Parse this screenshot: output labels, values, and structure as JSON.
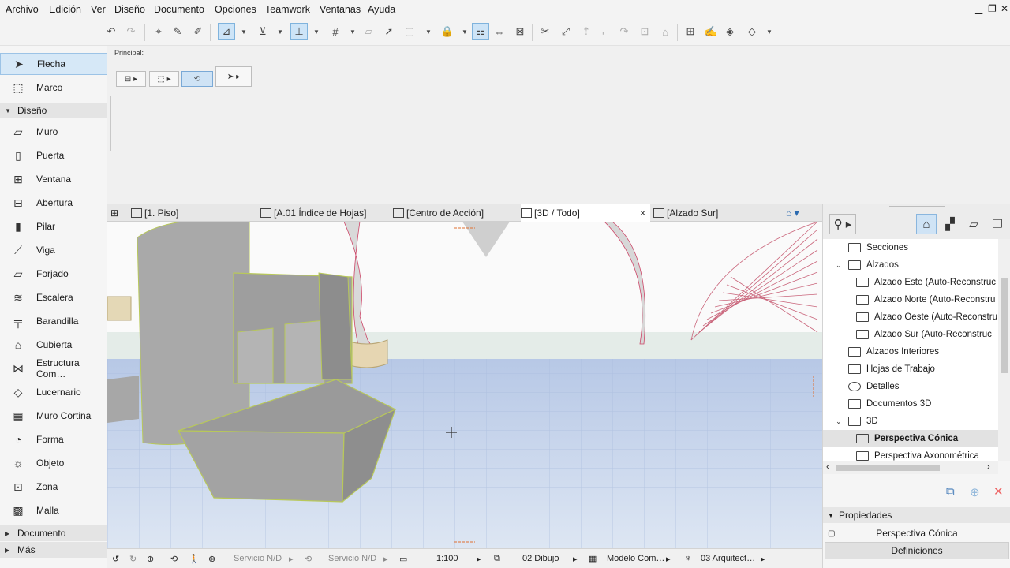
{
  "menu": [
    "Archivo",
    "Edición",
    "Ver",
    "Diseño",
    "Documento",
    "Opciones",
    "Teamwork",
    "Ventanas",
    "Ayuda"
  ],
  "infobox": {
    "label": "Principal:"
  },
  "toolbox": {
    "top_items": [
      {
        "label": "Flecha",
        "icon": "arrow-icon"
      },
      {
        "label": "Marco",
        "icon": "marquee-icon"
      }
    ],
    "group_diseno": "Diseño",
    "items": [
      {
        "label": "Muro",
        "icon": "wall-icon"
      },
      {
        "label": "Puerta",
        "icon": "door-icon"
      },
      {
        "label": "Ventana",
        "icon": "window-icon"
      },
      {
        "label": "Abertura",
        "icon": "opening-icon"
      },
      {
        "label": "Pilar",
        "icon": "column-icon"
      },
      {
        "label": "Viga",
        "icon": "beam-icon"
      },
      {
        "label": "Forjado",
        "icon": "slab-icon"
      },
      {
        "label": "Escalera",
        "icon": "stair-icon"
      },
      {
        "label": "Barandilla",
        "icon": "railing-icon"
      },
      {
        "label": "Cubierta",
        "icon": "roof-icon"
      },
      {
        "label": "Estructura Com…",
        "icon": "shell-icon"
      },
      {
        "label": "Lucernario",
        "icon": "skylight-icon"
      },
      {
        "label": "Muro Cortina",
        "icon": "curtain-wall-icon"
      },
      {
        "label": "Forma",
        "icon": "morph-icon"
      },
      {
        "label": "Objeto",
        "icon": "object-icon"
      },
      {
        "label": "Zona",
        "icon": "zone-icon"
      },
      {
        "label": "Malla",
        "icon": "mesh-icon"
      }
    ],
    "group_documento": "Documento",
    "group_mas": "Más"
  },
  "tabs": [
    {
      "label": "[1. Piso]"
    },
    {
      "label": "[A.01 Índice de Hojas]"
    },
    {
      "label": "[Centro de Acción]"
    },
    {
      "label": "[3D / Todo]",
      "close": "×"
    },
    {
      "label": "[Alzado Sur]"
    }
  ],
  "navigator": {
    "tree": [
      {
        "label": "Secciones",
        "level": 1
      },
      {
        "label": "Alzados",
        "level": 1,
        "expander": "⌄"
      },
      {
        "label": "Alzado Este (Auto-Reconstruc",
        "level": 2
      },
      {
        "label": "Alzado Norte (Auto-Reconstru",
        "level": 2
      },
      {
        "label": "Alzado Oeste (Auto-Reconstru",
        "level": 2
      },
      {
        "label": "Alzado Sur (Auto-Reconstruc",
        "level": 2
      },
      {
        "label": "Alzados Interiores",
        "level": 1
      },
      {
        "label": "Hojas de Trabajo",
        "level": 1
      },
      {
        "label": "Detalles",
        "level": 1
      },
      {
        "label": "Documentos 3D",
        "level": 1
      },
      {
        "label": "3D",
        "level": 1,
        "expander": "⌄"
      },
      {
        "label": "Perspectiva Cónica",
        "level": 2,
        "selected": true
      },
      {
        "label": "Perspectiva Axonométrica",
        "level": 2
      }
    ]
  },
  "properties": {
    "header": "Propiedades",
    "value": "Perspectiva Cónica",
    "button": "Definiciones"
  },
  "status": {
    "servicio1": "Servicio N/D",
    "servicio2": "Servicio N/D",
    "scale": "1:100",
    "layer": "02 Dibujo",
    "model": "Modelo Com…",
    "arch": "03 Arquitect…"
  },
  "colors": {
    "accent": "#cde4f7",
    "selection_outline": "#b8c85a",
    "floor": "#c9d6ec"
  }
}
